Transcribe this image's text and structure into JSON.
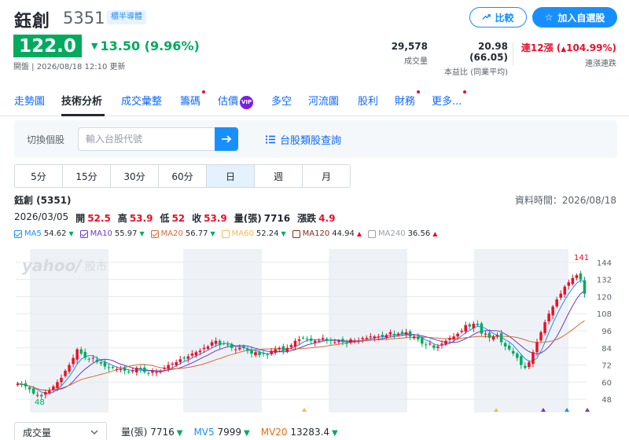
{
  "header": {
    "name": "鈺創",
    "code": "5351",
    "badge": "櫃半導體",
    "compare_label": "比較",
    "watchlist_label": "加入自選股"
  },
  "quote": {
    "price": "122.0",
    "change": "13.50 (9.96%)",
    "update_time": "開盤 | 2026/08/18 12:10 更新",
    "volume": "29,578",
    "volume_label": "成交量",
    "pe": "20.98 (66.05)",
    "pe_label": "本益比 (同業平均)",
    "streak": "連12漲 (",
    "streak_pct": "104.99%)",
    "streak_label": "連漲連跌"
  },
  "tabs": [
    {
      "label": "走勢圖",
      "active": false
    },
    {
      "label": "技術分析",
      "active": true
    },
    {
      "label": "成交彙整",
      "active": false
    },
    {
      "label": "籌碼",
      "active": false,
      "dot": true
    },
    {
      "label": "估價",
      "active": false,
      "vip": "VIP"
    },
    {
      "label": "多空",
      "active": false
    },
    {
      "label": "河流圖",
      "active": false
    },
    {
      "label": "股利",
      "active": false
    },
    {
      "label": "財務",
      "active": false,
      "dot": true
    },
    {
      "label": "更多...",
      "active": false,
      "dot": true
    }
  ],
  "search": {
    "label": "切換個股",
    "placeholder": "輸入台股代號",
    "industry_link": "台股類股查詢"
  },
  "periods": [
    {
      "label": "5分",
      "active": false
    },
    {
      "label": "15分",
      "active": false
    },
    {
      "label": "30分",
      "active": false
    },
    {
      "label": "60分",
      "active": false
    },
    {
      "label": "日",
      "active": true
    },
    {
      "label": "週",
      "active": false
    },
    {
      "label": "月",
      "active": false
    }
  ],
  "chart_info": {
    "title": "鈺創 (5351)",
    "data_time": "資料時間：2026/08/18",
    "date": "2026/03/05",
    "open_label": "開",
    "open": "52.5",
    "high_label": "高",
    "high": "53.9",
    "low_label": "低",
    "low": "52",
    "close_label": "收",
    "close": "53.9",
    "vol_label": "量(張)",
    "vol": "7716",
    "chg_label": "漲跌",
    "chg": "4.9"
  },
  "ma_legend": [
    {
      "label": "MA5",
      "value": "54.62",
      "dir": "down",
      "color": "#188fff",
      "checked": true
    },
    {
      "label": "MA10",
      "value": "55.97",
      "dir": "down",
      "color": "#6e38c9",
      "checked": true
    },
    {
      "label": "MA20",
      "value": "56.77",
      "dir": "down",
      "color": "#d86a32",
      "checked": true
    },
    {
      "label": "MA60",
      "value": "52.24",
      "dir": "down",
      "color": "#f6b94e",
      "checked": false
    },
    {
      "label": "MA120",
      "value": "44.94",
      "dir": "up",
      "color": "#8b2a1c",
      "checked": false
    },
    {
      "label": "MA240",
      "value": "36.56",
      "dir": "up",
      "color": "#9aa1a8",
      "checked": false
    }
  ],
  "chart_data": {
    "type": "candlestick",
    "y_ticks": [
      "144",
      "132",
      "120",
      "108",
      "96",
      "84",
      "72",
      "60",
      "48"
    ],
    "ylim": [
      42,
      150
    ],
    "max_label": "141",
    "min_label": "48",
    "colors": {
      "up": "#eb0f29",
      "down": "#00ab5e",
      "ma5": "#188fff",
      "ma10": "#6e38c9",
      "ma20": "#d86a32"
    },
    "close": [
      59,
      58,
      57,
      55,
      52,
      51,
      50,
      53,
      54,
      57,
      60,
      63,
      68,
      72,
      77,
      83,
      80,
      77,
      76,
      77,
      74,
      73,
      71,
      70,
      70,
      69,
      69,
      68,
      67,
      68,
      70,
      69,
      67,
      66,
      68,
      67,
      68,
      70,
      72,
      73,
      74,
      76,
      77,
      78,
      80,
      81,
      82,
      84,
      85,
      88,
      89,
      86,
      87,
      86,
      84,
      83,
      84,
      84,
      82,
      80,
      81,
      79,
      80,
      79,
      82,
      83,
      84,
      82,
      84,
      86,
      89,
      90,
      91,
      90,
      89,
      89,
      89,
      91,
      89,
      89,
      88,
      89,
      88,
      87,
      90,
      89,
      89,
      91,
      91,
      92,
      92,
      92,
      92,
      93,
      95,
      93,
      94,
      94,
      95,
      92,
      92,
      90,
      87,
      86,
      87,
      84,
      85,
      87,
      89,
      91,
      92,
      94,
      96,
      100,
      99,
      101,
      100,
      94,
      94,
      91,
      92,
      93,
      88,
      85,
      83,
      80,
      77,
      72,
      70,
      74,
      81,
      88,
      95,
      102,
      108,
      113,
      118,
      122,
      127,
      130,
      133,
      135,
      132,
      122
    ]
  },
  "volume_bar": {
    "select": "成交量",
    "vol_label": "量(張)",
    "vol_value": "7716",
    "mv5_label": "MV5",
    "mv5_value": "7999",
    "mv20_label": "MV20",
    "mv20_value": "13283.4"
  }
}
